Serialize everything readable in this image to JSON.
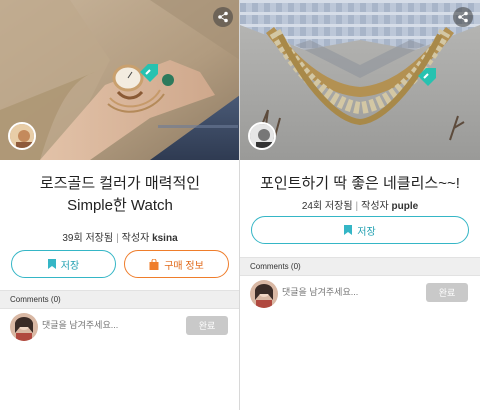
{
  "left_card": {
    "title_line1": "로즈골드 컬러가 매력적인",
    "title_line2": "Simple한 Watch",
    "save_count_text": "39회 저장됨",
    "author_label": "작성자",
    "author_name": "ksina",
    "save_button_label": "저장",
    "buy_button_label": "구매 정보",
    "comments_header": "Comments (0)",
    "comment_placeholder": "댓글을 남겨주세요...",
    "submit_label": "완료"
  },
  "right_card": {
    "title": "포인트하기 딱 좋은 네클리스~~!",
    "save_count_text": "24회 저장됨",
    "author_label": "작성자",
    "author_name": "puple",
    "save_button_label": "저장",
    "comments_header": "Comments (0)",
    "comment_placeholder": "댓글을 남겨주세요...",
    "submit_label": "완료"
  },
  "icons": [
    "share-icon",
    "tag-icon",
    "bookmark-icon",
    "shopping-bag-icon"
  ],
  "colors": {
    "accent_teal": "#35b6c6",
    "accent_orange": "#ef7d2b",
    "submit_gray": "#c9c9c9",
    "comments_bg": "#efefef"
  }
}
